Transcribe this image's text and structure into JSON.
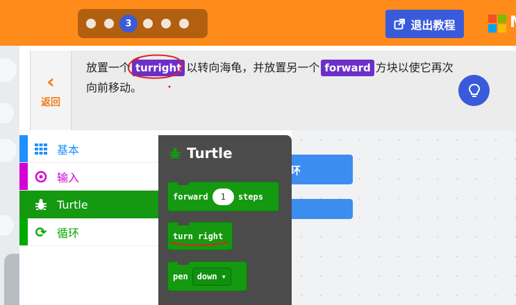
{
  "progress": {
    "dots": [
      "",
      "",
      "3",
      "",
      "",
      ""
    ],
    "current_label": "3"
  },
  "header": {
    "exit_label": "退出教程",
    "brand_letter": "M",
    "brand_colors": [
      "#f25022",
      "#7fba00",
      "#00a4ef",
      "#ffb900"
    ]
  },
  "instruction": {
    "back_label": "返回",
    "text_part1": "放置一个",
    "kw1": "turright",
    "text_part2": "以转向海龟，并放置另一个",
    "kw2": "forward",
    "text_part3": "方块以使它再次向前移动。"
  },
  "categories": [
    {
      "label": "基本",
      "icon": "grid-icon",
      "color": "#1e90ff"
    },
    {
      "label": "输入",
      "icon": "target-icon",
      "color": "#d400d4"
    },
    {
      "label": "Turtle",
      "icon": "bug-icon",
      "color": "#149911",
      "selected": true
    },
    {
      "label": "循环",
      "icon": "refresh-icon",
      "color": "#00aa00"
    }
  ],
  "flyout": {
    "title": "Turtle",
    "forward": {
      "keyword": "forward",
      "value": "1",
      "suffix": "steps"
    },
    "turn_right": {
      "label": "turn right"
    },
    "pen": {
      "keyword": "pen",
      "option": "down"
    }
  },
  "workspace": {
    "block1_fragment": "环"
  },
  "colors": {
    "topbar": "#ff8c1a",
    "accent": "#3a5bd9",
    "keyword": "#6c2fc7",
    "turtle": "#149911"
  }
}
